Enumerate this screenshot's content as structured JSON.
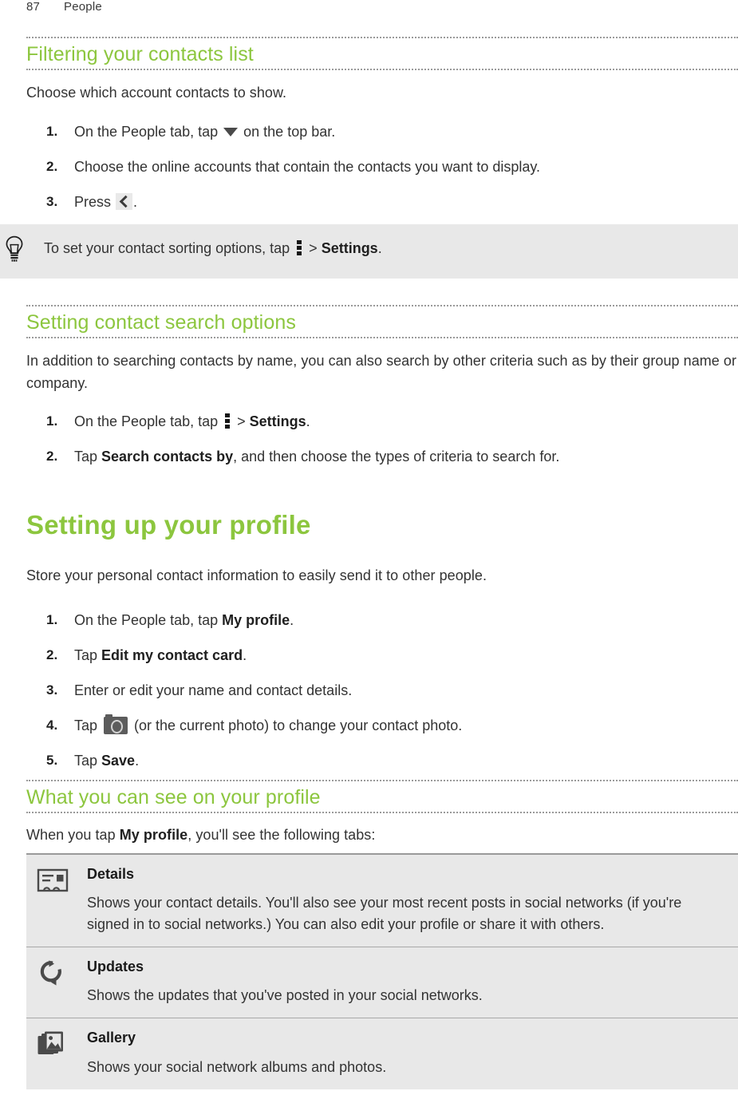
{
  "header": {
    "page_number": "87",
    "section": "People"
  },
  "accent_color": "#8cc63e",
  "sections": {
    "filtering": {
      "heading": "Filtering your contacts list",
      "intro": "Choose which account contacts to show.",
      "steps": [
        {
          "num": "1.",
          "pre": "On the People tab, tap ",
          "icon": "caret-down-icon",
          "post": " on the top bar."
        },
        {
          "num": "2.",
          "pre": "Choose the online accounts that contain the contacts you want to display.",
          "icon": "",
          "post": ""
        },
        {
          "num": "3.",
          "pre": "Press ",
          "icon": "back-arrow-icon",
          "post": "."
        }
      ]
    },
    "tip": {
      "icon": "lightbulb-icon",
      "pre": "To set your contact sorting options, tap ",
      "icon_inline": "kebab-menu-icon",
      "mid": " > ",
      "bold": "Settings",
      "post": "."
    },
    "search_options": {
      "heading": "Setting contact search options",
      "intro": "In addition to searching contacts by name, you can also search by other criteria such as by their group name or company.",
      "steps": [
        {
          "num": "1.",
          "pre": "On the People tab, tap ",
          "icon": "kebab-menu-icon",
          "mid": " > ",
          "bold": "Settings",
          "post": "."
        },
        {
          "num": "2.",
          "pre": "Tap ",
          "icon": "",
          "mid": "",
          "bold": "Search contacts by",
          "post": ", and then choose the types of criteria to search for."
        }
      ]
    },
    "profile": {
      "heading": "Setting up your profile",
      "intro": "Store your personal contact information to easily send it to other people.",
      "steps": [
        {
          "num": "1.",
          "pre": "On the People tab, tap ",
          "bold": "My profile",
          "post": "."
        },
        {
          "num": "2.",
          "pre": "Tap ",
          "bold": "Edit my contact card",
          "post": "."
        },
        {
          "num": "3.",
          "pre": "Enter or edit your name and contact details.",
          "bold": "",
          "post": ""
        },
        {
          "num": "4.",
          "pre": "Tap ",
          "icon": "camera-icon",
          "bold": "",
          "post": " (or the current photo) to change your contact photo."
        },
        {
          "num": "5.",
          "pre": "Tap ",
          "bold": "Save",
          "post": "."
        }
      ]
    },
    "what_you_see": {
      "heading": "What you can see on your profile",
      "intro_pre": "When you tap ",
      "intro_bold": "My profile",
      "intro_post": ", you'll see the following tabs:",
      "tabs": [
        {
          "icon": "contact-card-icon",
          "title": "Details",
          "desc": "Shows your contact details. You'll also see your most recent posts in social networks (if you're signed in to social networks.) You can also edit your profile or share it with others."
        },
        {
          "icon": "refresh-icon",
          "title": "Updates",
          "desc": "Shows the updates that you've posted in your social networks."
        },
        {
          "icon": "gallery-icon",
          "title": "Gallery",
          "desc": "Shows your social network albums and photos."
        }
      ]
    }
  }
}
